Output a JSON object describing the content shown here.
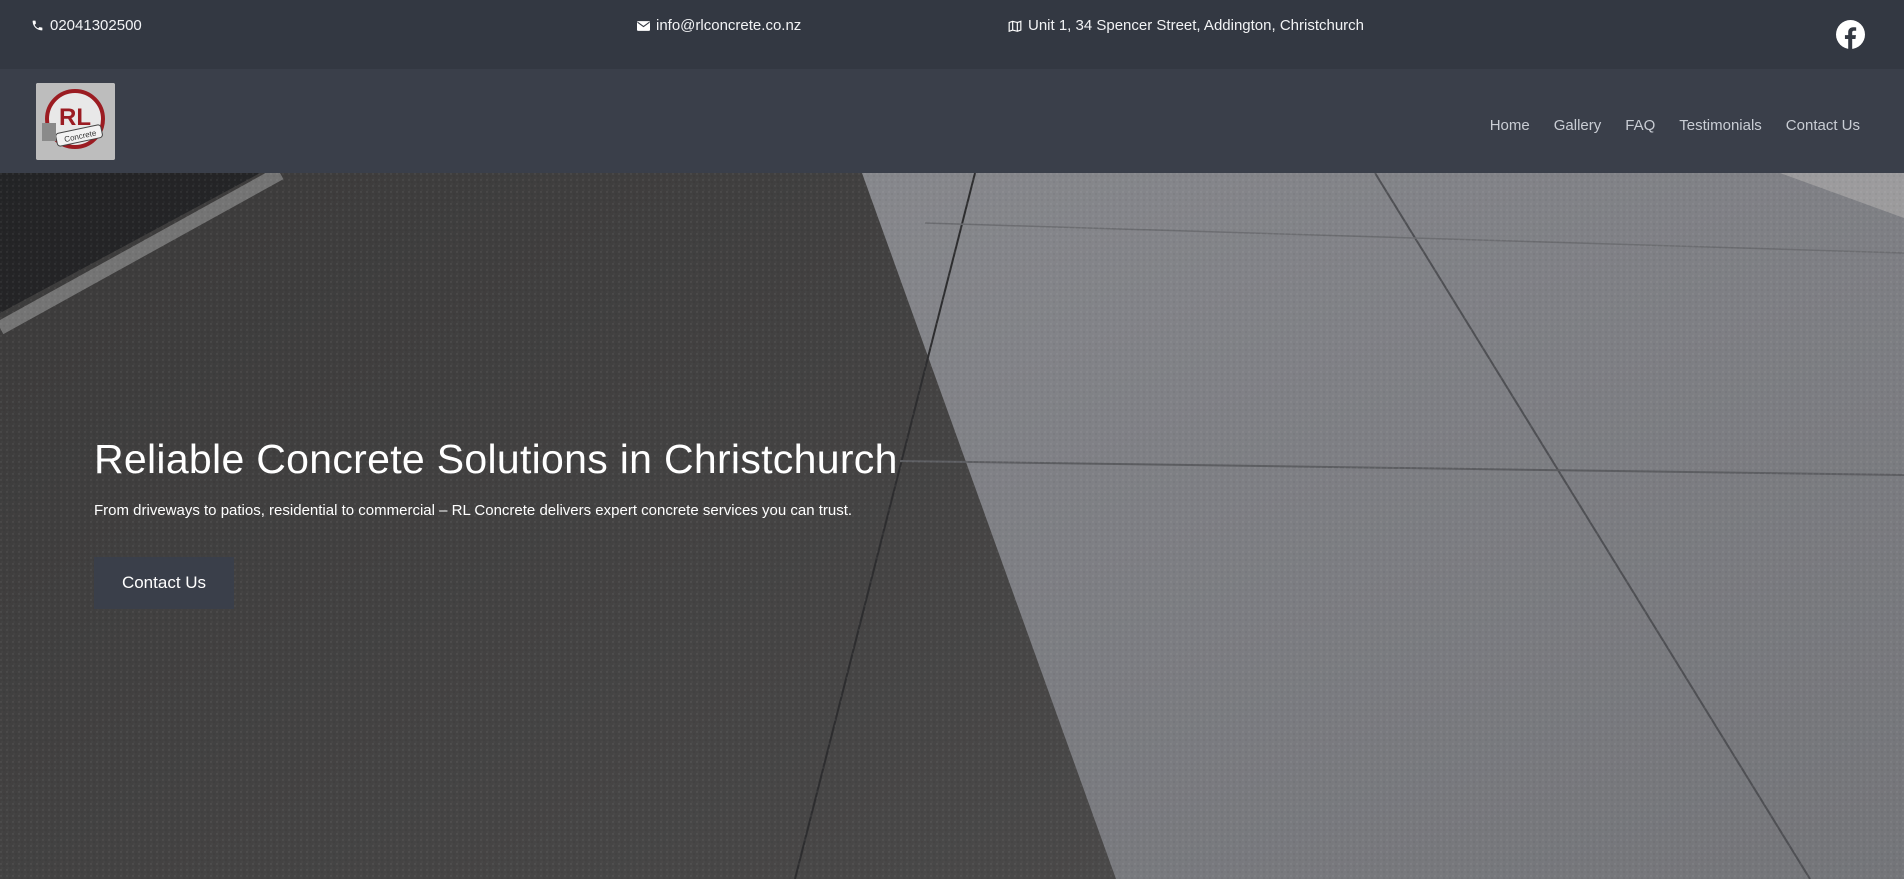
{
  "topbar": {
    "phone": "02041302500",
    "email": "info@rlconcrete.co.nz",
    "address": "Unit 1, 34 Spencer Street, Addington, Christchurch",
    "phone_icon": "phone-icon",
    "email_icon": "envelope-icon",
    "address_icon": "map-icon",
    "social_icon": "facebook-icon"
  },
  "logo": {
    "text_main": "RL",
    "text_sub": "Concrete"
  },
  "nav": {
    "items": [
      {
        "label": "Home"
      },
      {
        "label": "Gallery"
      },
      {
        "label": "FAQ"
      },
      {
        "label": "Testimonials"
      },
      {
        "label": "Contact Us"
      }
    ]
  },
  "hero": {
    "title": "Reliable Concrete Solutions in Christchurch",
    "subtitle": "From driveways to patios, residential to commercial – RL Concrete delivers expert concrete services you can trust.",
    "cta_label": "Contact Us"
  },
  "colors": {
    "topbar_bg": "#333842",
    "navbar_bg": "#3a3f4a",
    "button_bg": "#3a3f4a",
    "logo_red": "#9b1c22"
  }
}
